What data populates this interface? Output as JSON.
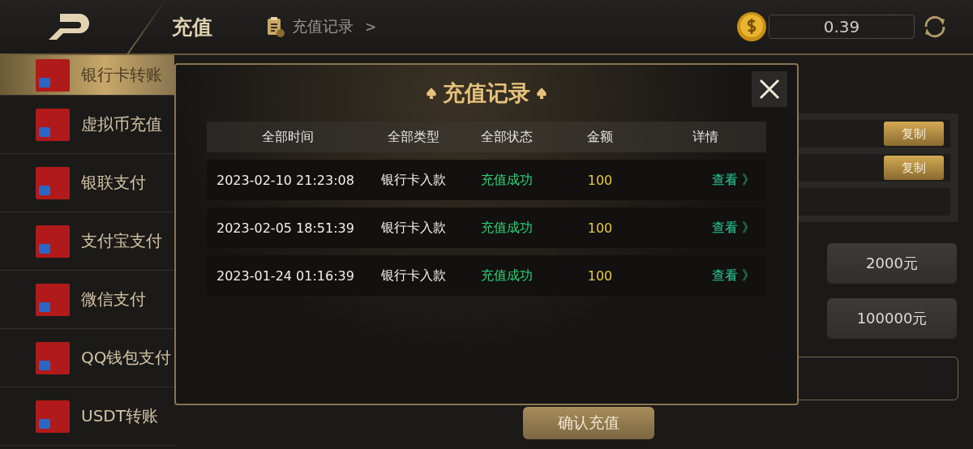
{
  "header": {
    "title": "充值",
    "records_link": "充值记录",
    "records_arrow": ">",
    "balance": "0.39"
  },
  "sidebar": {
    "items": [
      {
        "label": "银行卡转账",
        "selected": true
      },
      {
        "label": "虚拟币充值",
        "selected": false
      },
      {
        "label": "银联支付",
        "selected": false
      },
      {
        "label": "支付宝支付",
        "selected": false
      },
      {
        "label": "微信支付",
        "selected": false
      },
      {
        "label": "QQ钱包支付",
        "selected": false
      },
      {
        "label": "USDT转账",
        "selected": false
      }
    ]
  },
  "account_rows": [
    {
      "button": "复制"
    },
    {
      "button": "复制"
    }
  ],
  "amounts": [
    "2000元",
    "100000元"
  ],
  "confirm_button": "确认充值",
  "dialog": {
    "title": "充值记录",
    "columns": [
      "全部时间",
      "全部类型",
      "全部状态",
      "金额",
      "详情"
    ],
    "rows": [
      {
        "time": "2023-02-10 21:23:08",
        "type": "银行卡入款",
        "status": "充值成功",
        "amount": "100",
        "detail": "查看 》"
      },
      {
        "time": "2023-02-05 18:51:39",
        "type": "银行卡入款",
        "status": "充值成功",
        "amount": "100",
        "detail": "查看 》"
      },
      {
        "time": "2023-01-24 01:16:39",
        "type": "银行卡入款",
        "status": "充值成功",
        "amount": "100",
        "detail": "查看 》"
      }
    ]
  }
}
